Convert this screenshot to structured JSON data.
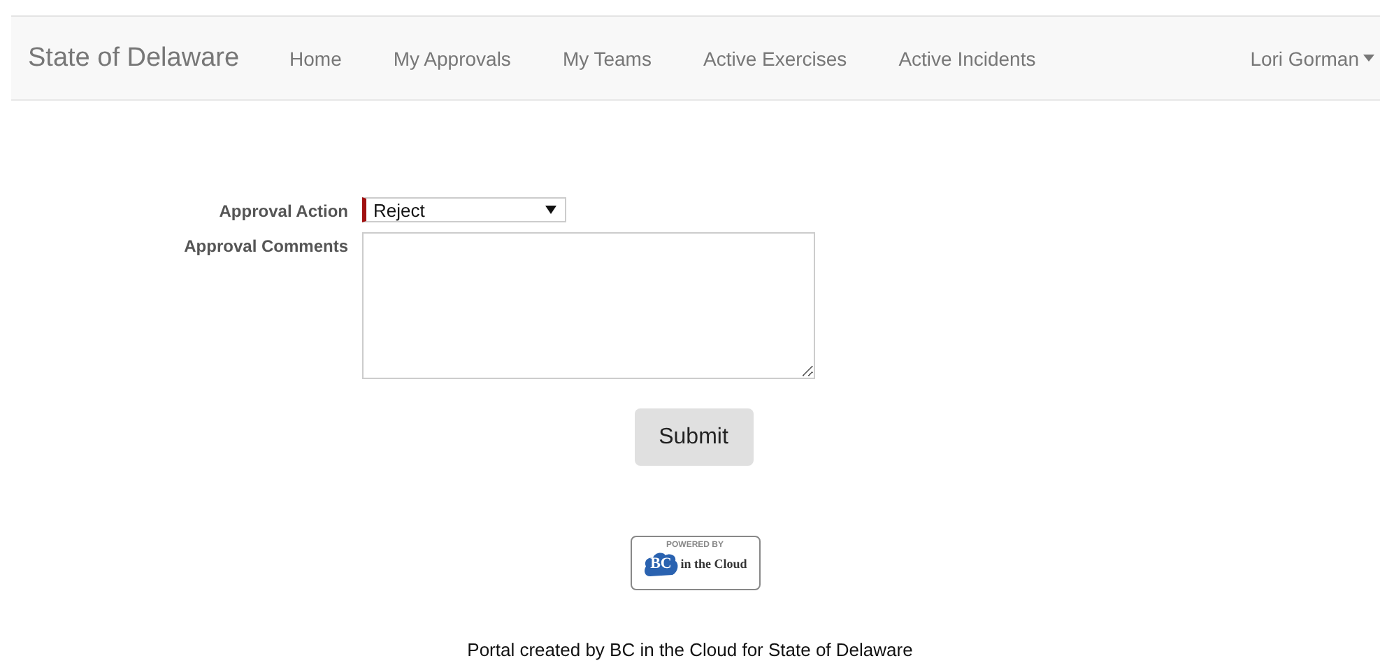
{
  "navbar": {
    "brand": "State of Delaware",
    "items": [
      {
        "label": "Home",
        "selected": false
      },
      {
        "label": "My Approvals",
        "selected": false
      },
      {
        "label": "My Teams",
        "selected": false
      },
      {
        "label": "Active Exercises",
        "selected": false
      },
      {
        "label": "Active Incidents",
        "selected": false
      }
    ],
    "user": "Lori Gorman"
  },
  "form": {
    "fields": [
      {
        "kind": "select",
        "label": "Approval Action",
        "value": "Reject",
        "required": true
      },
      {
        "kind": "textarea",
        "label": "Approval Comments"
      }
    ],
    "submit": "Submit"
  },
  "logo": {
    "top": "POWERED BY",
    "mark": "BC",
    "name": "in the Cloud"
  },
  "footer": "Portal created by BC in the Cloud for State of Delaware"
}
